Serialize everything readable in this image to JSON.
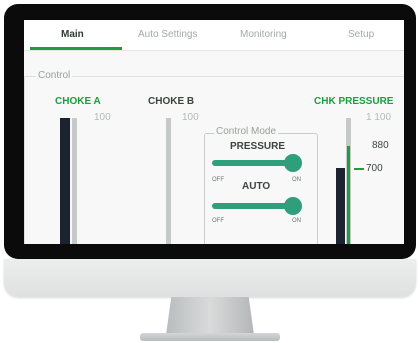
{
  "tabs": [
    {
      "label": "Main",
      "active": true
    },
    {
      "label": "Auto Settings",
      "active": false
    },
    {
      "label": "Monitoring",
      "active": false
    },
    {
      "label": "Setup",
      "active": false
    }
  ],
  "control_group": {
    "legend": "Control"
  },
  "choke_a": {
    "title": "CHOKE A",
    "scale_max": "100",
    "title_color": "#1c9e3d"
  },
  "choke_b": {
    "title": "CHOKE B",
    "scale_max": "100"
  },
  "control_mode": {
    "legend": "Control Mode",
    "pressure_switch": {
      "label": "PRESSURE",
      "off_label": "OFF",
      "on_label": "ON",
      "state": "on"
    },
    "auto_switch": {
      "label": "AUTO",
      "off_label": "OFF",
      "on_label": "ON",
      "state": "on"
    },
    "switch_color": "#2e9e7b"
  },
  "chk_pressure": {
    "title": "CHK PRESSURE",
    "scale_max": "1 100",
    "value_label": "880",
    "setpoint_label": "700",
    "title_color": "#1c9e3d",
    "indicator_color": "#1c9e3d"
  }
}
